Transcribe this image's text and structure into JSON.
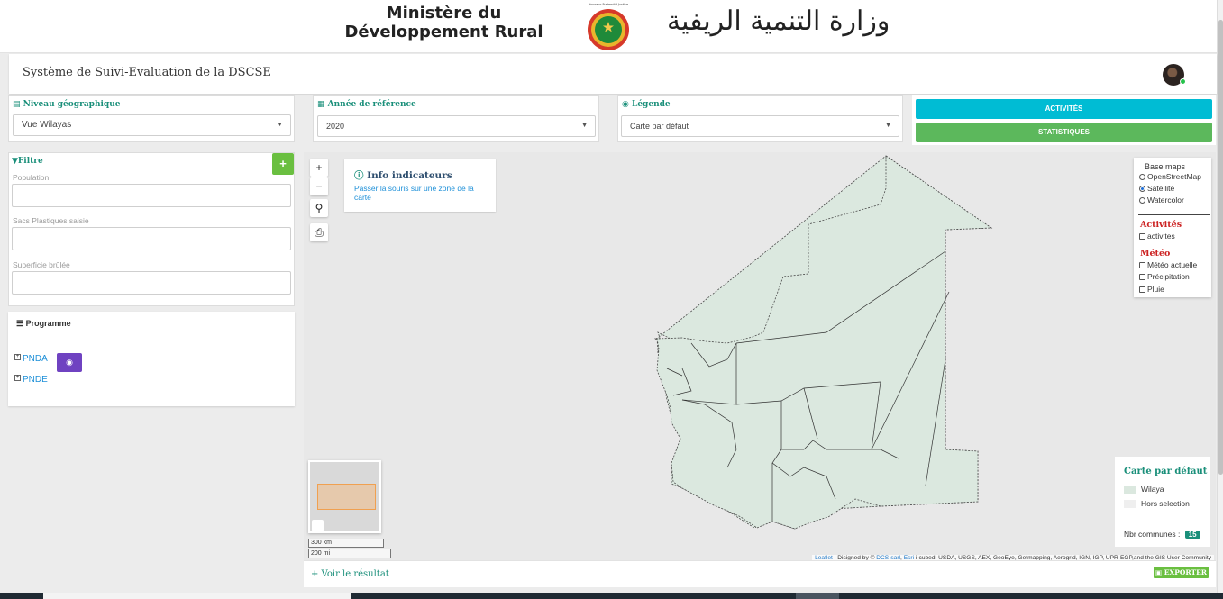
{
  "header": {
    "ministry_fr": "Ministère du Développement Rural",
    "ministry_ar": "وزارة التنمية الريفية",
    "emblem_motto": "Honneur Fraternité Justice"
  },
  "app": {
    "title": "Système de Suivi-Evaluation de la DSCSE"
  },
  "filters": {
    "niveau": {
      "label": "Niveau géographique",
      "value": "Vue Wilayas"
    },
    "annee": {
      "label": "Année de référence",
      "value": "2020"
    },
    "legende": {
      "label": "Légende",
      "value": "Carte par défaut"
    }
  },
  "buttons": {
    "activites": "ACTIVITÉS",
    "statistiques": "STATISTIQUES",
    "add": "+"
  },
  "filtre": {
    "title": "Filtre",
    "fields": [
      "Population",
      "Sacs Plastiques saisie",
      "Superficie brûlée"
    ]
  },
  "programme": {
    "title": "Programme",
    "items": [
      "PNDA",
      "PNDE"
    ]
  },
  "map": {
    "zoom_in": "+",
    "zoom_out": "−",
    "info_title": "Info indicateurs",
    "info_text": "Passer la souris sur une zone de la carte",
    "base_maps_label": "Base maps",
    "base_maps": [
      "OpenStreetMap",
      "Satellite",
      "Watercolor"
    ],
    "base_map_selected": "Satellite",
    "activites_section": "Activités",
    "activites_layers": [
      "activites"
    ],
    "meteo_section": "Météo",
    "meteo_layers": [
      "Météo actuelle",
      "Précipitation",
      "Pluie"
    ],
    "legend": {
      "title": "Carte par défaut",
      "items": [
        {
          "label": "Wilaya",
          "color": "#dbe8df"
        },
        {
          "label": "Hors selection",
          "color": "#efefef"
        }
      ],
      "count_label": "Nbr communes :",
      "count": "15"
    },
    "scale_km": "300 km",
    "scale_mi": "200 mi",
    "attribution_leaflet": "Leaflet",
    "attribution_designed": " | Disigned by © ",
    "attribution_dcs": "DCS-sarl",
    "attribution_esri": "Esri",
    "attribution_rest": " i-cubed, USDA, USGS, AEX, GeoEye, Getmapping, Aerogrid, IGN, IGP, UPR-EGP,and the GIS User Community"
  },
  "result": {
    "link": "+ Voir le résultat",
    "export": "EXPORTER"
  },
  "colors": {
    "accent": "#1a8f7a",
    "activites_btn": "#00bcd4",
    "statistiques_btn": "#5cb85c",
    "purple": "#6f42c1"
  }
}
